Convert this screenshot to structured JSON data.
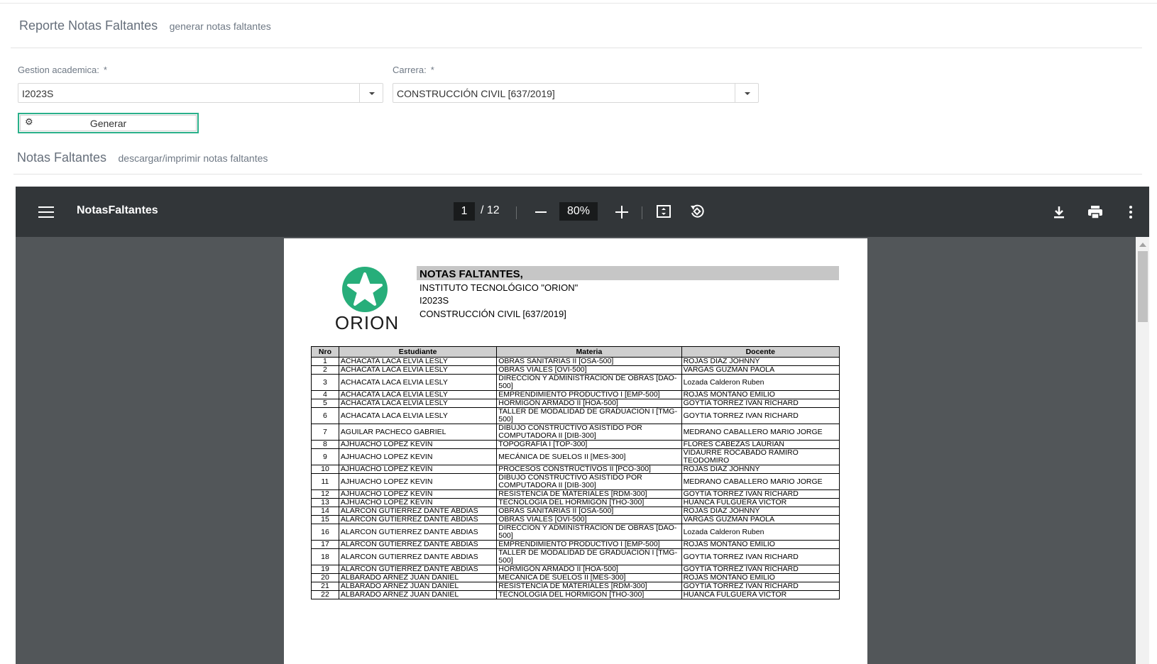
{
  "section1": {
    "title": "Reporte Notas Faltantes",
    "subtitle": "generar notas faltantes"
  },
  "form": {
    "gestion_label": "Gestion academica:",
    "gestion_value": "I2023S",
    "carrera_label": "Carrera:",
    "carrera_value": "CONSTRUCCIÓN CIVIL [637/2019]",
    "required_mark": "*",
    "generate_label": "Generar",
    "accent_color": "#2ab08a"
  },
  "section2": {
    "title": "Notas Faltantes",
    "subtitle": "descargar/imprimir notas faltantes"
  },
  "viewer": {
    "doc_title": "NotasFaltantes",
    "current_page": "1",
    "total_pages": "/ 12",
    "zoom": "80%",
    "icons": [
      "menu-icon",
      "zoom-out-icon",
      "zoom-in-icon",
      "fit-page-icon",
      "rotate-icon",
      "download-icon",
      "print-icon",
      "more-icon"
    ]
  },
  "report": {
    "logo_text": "ORION",
    "title": "NOTAS FALTANTES,",
    "institute": "INSTITUTO TECNOLÓGICO  \"ORION\"",
    "gestion": "I2023S",
    "carrera": "CONSTRUCCIÓN CIVIL [637/2019]",
    "columns": [
      "Nro",
      "Estudiante",
      "Materia",
      "Docente"
    ],
    "rows": [
      [
        "1",
        "ACHACATA LACA ELVIA LESLY",
        "OBRAS SANITARIAS II [OSA-500]",
        "ROJAS DIAZ JOHNNY"
      ],
      [
        "2",
        "ACHACATA LACA ELVIA LESLY",
        "OBRAS VIALES [OVI-500]",
        "VARGAS  GUZMAN PAOLA"
      ],
      [
        "3",
        "ACHACATA LACA ELVIA LESLY",
        "DIRECCIÓN Y ADMINISTRACIÓN DE OBRAS [DAO-500]",
        "Lozada Calderon Ruben"
      ],
      [
        "4",
        "ACHACATA LACA ELVIA LESLY",
        "EMPRENDIMIENTO PRODUCTIVO I [EMP-500]",
        "ROJAS MONTAÑO EMILIO"
      ],
      [
        "5",
        "ACHACATA LACA ELVIA LESLY",
        "HORMIGÓN ARMADO II [HOA-500]",
        "GOYTIA TORREZ IVAN RICHARD"
      ],
      [
        "6",
        "ACHACATA LACA ELVIA LESLY",
        "TALLER DE MODALIDAD DE GRADUACIÓN I [TMG-500]",
        "GOYTIA TORREZ IVAN RICHARD"
      ],
      [
        "7",
        "AGUILAR PACHECO GABRIEL",
        "DIBUJO CONSTRUCTIVO ASISTIDO POR COMPUTADORA II [DIB-300]",
        "MEDRANO CABALLERO MARIO JORGE"
      ],
      [
        "8",
        "AJHUACHO LOPEZ KEVIN",
        "TOPOGRAFÍA I [TOP-300]",
        "FLORES CABEZAS LAURIAN"
      ],
      [
        "9",
        "AJHUACHO LOPEZ KEVIN",
        "MECÁNICA DE SUELOS II [MES-300]",
        "VIDAURRE ROCABADO RAMIRO TEODOMIRO"
      ],
      [
        "10",
        "AJHUACHO LOPEZ KEVIN",
        "PROCESOS CONSTRUCTIVOS II [PCO-300]",
        "ROJAS DIAZ JOHNNY"
      ],
      [
        "11",
        "AJHUACHO LOPEZ KEVIN",
        "DIBUJO CONSTRUCTIVO ASISTIDO POR COMPUTADORA II [DIB-300]",
        "MEDRANO CABALLERO MARIO JORGE"
      ],
      [
        "12",
        "AJHUACHO LOPEZ KEVIN",
        "RESISTENCIA DE MATERIALES [RDM-300]",
        "GOYTIA TORREZ IVAN RICHARD"
      ],
      [
        "13",
        "AJHUACHO LOPEZ KEVIN",
        "TECNOLOGÍA DEL HORMIGÓN [THO-300]",
        "HUANCA FULGUERA VICTOR"
      ],
      [
        "14",
        "ALARCON GUTIERREZ DANTE ABDIAS",
        "OBRAS SANITARIAS II [OSA-500]",
        "ROJAS DIAZ JOHNNY"
      ],
      [
        "15",
        "ALARCON GUTIERREZ DANTE ABDIAS",
        "OBRAS VIALES [OVI-500]",
        "VARGAS  GUZMAN PAOLA"
      ],
      [
        "16",
        "ALARCON GUTIERREZ DANTE ABDIAS",
        "DIRECCIÓN Y ADMINISTRACIÓN DE OBRAS [DAO-500]",
        "Lozada Calderon Ruben"
      ],
      [
        "17",
        "ALARCON GUTIERREZ DANTE ABDIAS",
        "EMPRENDIMIENTO PRODUCTIVO I [EMP-500]",
        "ROJAS MONTAÑO EMILIO"
      ],
      [
        "18",
        "ALARCON GUTIERREZ DANTE ABDIAS",
        "TALLER DE MODALIDAD DE GRADUACIÓN I [TMG-500]",
        "GOYTIA TORREZ IVAN RICHARD"
      ],
      [
        "19",
        "ALARCON GUTIERREZ DANTE ABDIAS",
        "HORMIGÓN ARMADO II [HOA-500]",
        "GOYTIA TORREZ IVAN RICHARD"
      ],
      [
        "20",
        "ALBARADO ARNEZ JUAN DANIEL",
        "MECÁNICA DE SUELOS II [MES-300]",
        "ROJAS MONTAÑO EMILIO"
      ],
      [
        "21",
        "ALBARADO ARNEZ JUAN DANIEL",
        "RESISTENCIA DE MATERIALES [RDM-300]",
        "GOYTIA TORREZ IVAN RICHARD"
      ],
      [
        "22",
        "ALBARADO ARNEZ JUAN DANIEL",
        "TECNOLOGÍA DEL HORMIGÓN [THO-300]",
        "HUANCA FULGUERA VICTOR"
      ]
    ]
  }
}
